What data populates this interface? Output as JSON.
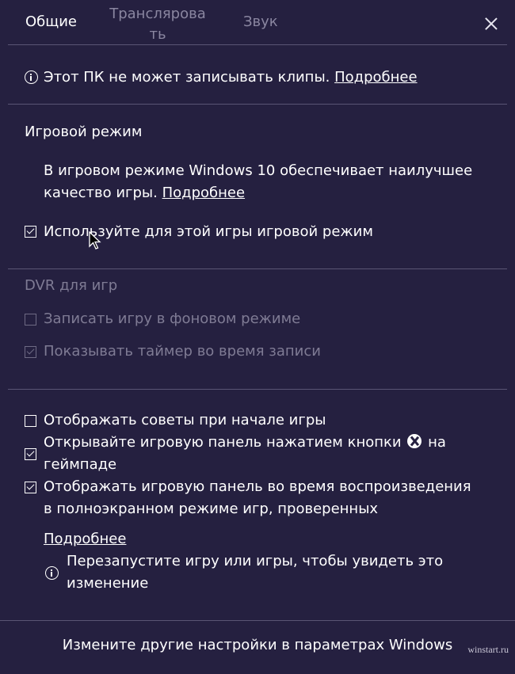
{
  "tabs": {
    "general": "Общие",
    "broadcast": "Трансляровать",
    "sound": "Звук"
  },
  "notice": {
    "text": "Этот ПК не может записывать клипы.",
    "link": "Подробнее"
  },
  "game_mode": {
    "title": "Игровой режим",
    "description_line1": "В игровом режиме Windows 10 обеспечивает наилучшее",
    "description_line2": "качество игры.",
    "link": "Подробнее",
    "checkbox_label": "Используйте для этой игры игровой режим",
    "checkbox_checked": true
  },
  "dvr": {
    "title": "DVR для игр",
    "background_record_label": "Записать игру в фоновом режиме",
    "background_record_checked": false,
    "show_timer_label": "Показывать таймер во время записи",
    "show_timer_checked": true
  },
  "options": {
    "tips_label": "Отображать советы при начале игры",
    "tips_checked": false,
    "open_panel_line1_a": "Открывайте игровую панель нажатием кнопки",
    "open_panel_line1_b": "на",
    "open_panel_line2": "геймпаде",
    "open_panel_checked": true,
    "fullscreen_line1": "Отображать игровую панель во время воспроизведения",
    "fullscreen_line2": "в полноэкранном режиме игр, проверенных",
    "fullscreen_checked": true,
    "more_link": "Подробнее",
    "restart_line1": "Перезапустите игру или игры, чтобы увидеть это",
    "restart_line2": "изменение"
  },
  "footer": {
    "settings_link": "Измените другие настройки в параметрах Windows",
    "watermark": "winstart.ru"
  }
}
